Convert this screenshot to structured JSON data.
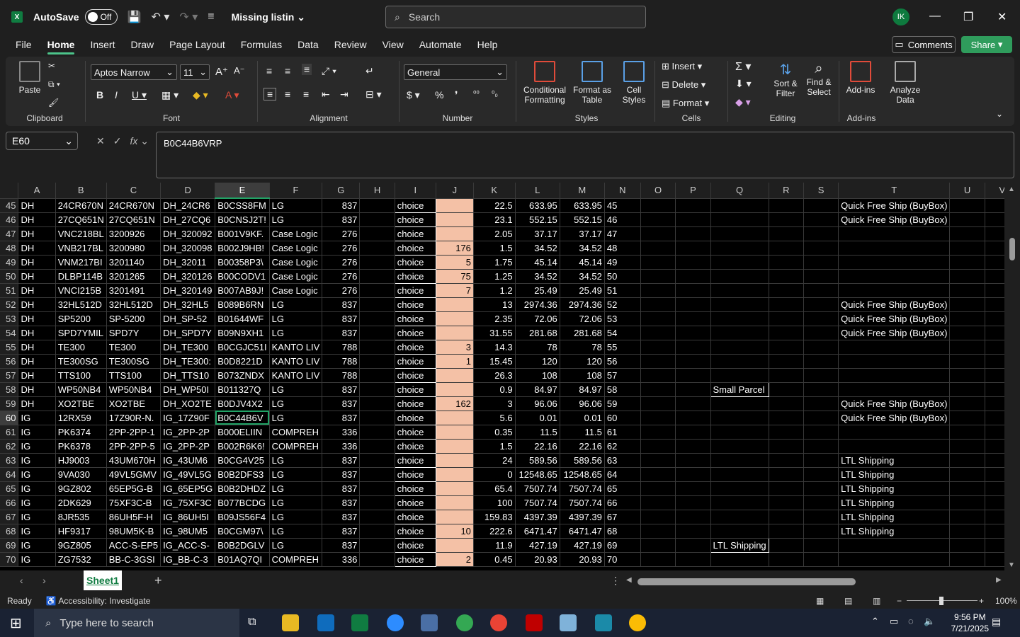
{
  "title": {
    "autosave": "AutoSave",
    "toggle": "Off",
    "doc_name": "Missing listin",
    "search_placeholder": "Search",
    "avatar": "IK"
  },
  "menu": [
    "File",
    "Home",
    "Insert",
    "Draw",
    "Page Layout",
    "Formulas",
    "Data",
    "Review",
    "View",
    "Automate",
    "Help"
  ],
  "comments": "Comments",
  "share": "Share",
  "ribbon": {
    "clipboard": {
      "paste": "Paste",
      "label": "Clipboard"
    },
    "font": {
      "family": "Aptos Narrow",
      "size": "11",
      "label": "Font"
    },
    "alignment": {
      "label": "Alignment"
    },
    "number": {
      "format": "General",
      "label": "Number"
    },
    "styles": {
      "cond": "Conditional Formatting",
      "fmt_table": "Format as Table",
      "cell_styles": "Cell Styles",
      "label": "Styles"
    },
    "cells": {
      "insert": "Insert",
      "delete": "Delete",
      "format": "Format",
      "label": "Cells"
    },
    "editing": {
      "sort": "Sort & Filter",
      "find": "Find & Select",
      "label": "Editing"
    },
    "addins": {
      "addins": "Add-ins",
      "analyze": "Analyze Data",
      "label": "Add-ins"
    }
  },
  "formula_bar": {
    "name_box": "E60",
    "value": "B0C44B6VRP"
  },
  "columns": [
    "A",
    "B",
    "C",
    "D",
    "E",
    "F",
    "G",
    "H",
    "I",
    "J",
    "K",
    "L",
    "M",
    "N",
    "O",
    "P",
    "Q",
    "R",
    "S",
    "T",
    "U",
    "V"
  ],
  "rows": [
    {
      "n": "45",
      "a": "DH",
      "b": "24CR670N",
      "c": "24CR670N",
      "d": "DH_24CR6",
      "e": "B0CSS8FM",
      "f": "LG",
      "g": "837",
      "i": "choice",
      "j": "",
      "k": "22.5",
      "l": "633.95",
      "m": "633.95",
      "q": "",
      "t": "Quick Free Ship (BuyBox)"
    },
    {
      "n": "46",
      "a": "DH",
      "b": "27CQ651N",
      "c": "27CQ651N",
      "d": "DH_27CQ6",
      "e": "B0CNSJ2T!",
      "f": "LG",
      "g": "837",
      "i": "choice",
      "j": "",
      "k": "23.1",
      "l": "552.15",
      "m": "552.15",
      "q": "",
      "t": "Quick Free Ship (BuyBox)"
    },
    {
      "n": "47",
      "a": "DH",
      "b": "VNC218BL",
      "c": "3200926",
      "d": "DH_320092",
      "e": "B001V9KF.",
      "f": "Case Logic",
      "g": "276",
      "i": "choice",
      "j": "",
      "k": "2.05",
      "l": "37.17",
      "m": "37.17",
      "q": "",
      "t": ""
    },
    {
      "n": "48",
      "a": "DH",
      "b": "VNB217BL",
      "c": "3200980",
      "d": "DH_320098",
      "e": "B002J9HB!",
      "f": "Case Logic",
      "g": "276",
      "i": "choice",
      "j": "176",
      "k": "1.5",
      "l": "34.52",
      "m": "34.52",
      "q": "",
      "t": ""
    },
    {
      "n": "49",
      "a": "DH",
      "b": "VNM217BI",
      "c": "3201140",
      "d": "DH_32011",
      "e": "B00358P3\\",
      "f": "Case Logic",
      "g": "276",
      "i": "choice",
      "j": "5",
      "k": "1.75",
      "l": "45.14",
      "m": "45.14",
      "q": "",
      "t": ""
    },
    {
      "n": "50",
      "a": "DH",
      "b": "DLBP114B",
      "c": "3201265",
      "d": "DH_320126",
      "e": "B00CODV1",
      "f": "Case Logic",
      "g": "276",
      "i": "choice",
      "j": "75",
      "k": "1.25",
      "l": "34.52",
      "m": "34.52",
      "q": "",
      "t": ""
    },
    {
      "n": "51",
      "a": "DH",
      "b": "VNCI215B",
      "c": "3201491",
      "d": "DH_320149",
      "e": "B007AB9J!",
      "f": "Case Logic",
      "g": "276",
      "i": "choice",
      "j": "7",
      "k": "1.2",
      "l": "25.49",
      "m": "25.49",
      "q": "",
      "t": ""
    },
    {
      "n": "52",
      "a": "DH",
      "b": "32HL512D",
      "c": "32HL512D",
      "d": "DH_32HL5",
      "e": "B089B6RN",
      "f": "LG",
      "g": "837",
      "i": "choice",
      "j": "",
      "k": "13",
      "l": "2974.36",
      "m": "2974.36",
      "q": "",
      "t": "Quick Free Ship (BuyBox)"
    },
    {
      "n": "53",
      "a": "DH",
      "b": "SP5200",
      "c": "SP-5200",
      "d": "DH_SP-52",
      "e": "B01644WF",
      "f": "LG",
      "g": "837",
      "i": "choice",
      "j": "",
      "k": "2.35",
      "l": "72.06",
      "m": "72.06",
      "q": "",
      "t": "Quick Free Ship (BuyBox)"
    },
    {
      "n": "54",
      "a": "DH",
      "b": "SPD7YMIL",
      "c": "SPD7Y",
      "d": "DH_SPD7Y",
      "e": "B09N9XH1",
      "f": "LG",
      "g": "837",
      "i": "choice",
      "j": "",
      "k": "31.55",
      "l": "281.68",
      "m": "281.68",
      "q": "",
      "t": "Quick Free Ship (BuyBox)"
    },
    {
      "n": "55",
      "a": "DH",
      "b": "TE300",
      "c": "TE300",
      "d": "DH_TE300",
      "e": "B0CGJC51I",
      "f": "KANTO LIV",
      "g": "788",
      "i": "choice",
      "j": "3",
      "k": "14.3",
      "l": "78",
      "m": "78",
      "q": "",
      "t": ""
    },
    {
      "n": "56",
      "a": "DH",
      "b": "TE300SG",
      "c": "TE300SG",
      "d": "DH_TE300:",
      "e": "B0D8221D",
      "f": "KANTO LIV",
      "g": "788",
      "i": "choice",
      "j": "1",
      "k": "15.45",
      "l": "120",
      "m": "120",
      "q": "",
      "t": ""
    },
    {
      "n": "57",
      "a": "DH",
      "b": "TTS100",
      "c": "TTS100",
      "d": "DH_TTS10",
      "e": "B073ZNDX",
      "f": "KANTO LIV",
      "g": "788",
      "i": "choice",
      "j": "",
      "k": "26.3",
      "l": "108",
      "m": "108",
      "q": "",
      "t": ""
    },
    {
      "n": "58",
      "a": "DH",
      "b": "WP50NB4",
      "c": "WP50NB4",
      "d": "DH_WP50I",
      "e": "B011327Q",
      "f": "LG",
      "g": "837",
      "i": "choice",
      "j": "",
      "k": "0.9",
      "l": "84.97",
      "m": "84.97",
      "q": "Small Parcel",
      "t": ""
    },
    {
      "n": "59",
      "a": "DH",
      "b": "XO2TBE",
      "c": "XO2TBE",
      "d": "DH_XO2TE",
      "e": "B0DJV4X2",
      "f": "LG",
      "g": "837",
      "i": "choice",
      "j": "162",
      "k": "3",
      "l": "96.06",
      "m": "96.06",
      "q": "",
      "t": "Quick Free Ship (BuyBox)"
    },
    {
      "n": "60",
      "a": "IG",
      "b": "12RX59",
      "c": "17Z90R-N.",
      "d": "IG_17Z90F",
      "e": "B0C44B6V",
      "f": "LG",
      "g": "837",
      "i": "choice",
      "j": "",
      "k": "5.6",
      "l": "0.01",
      "m": "0.01",
      "q": "",
      "t": "Quick Free Ship (BuyBox)"
    },
    {
      "n": "61",
      "a": "IG",
      "b": "PK6374",
      "c": "2PP-2PP-1",
      "d": "IG_2PP-2P",
      "e": "B000ELIIN",
      "f": "COMPREH",
      "g": "336",
      "i": "choice",
      "j": "",
      "k": "0.35",
      "l": "11.5",
      "m": "11.5",
      "q": "",
      "t": ""
    },
    {
      "n": "62",
      "a": "IG",
      "b": "PK6378",
      "c": "2PP-2PP-5",
      "d": "IG_2PP-2P",
      "e": "B002R6K6!",
      "f": "COMPREH",
      "g": "336",
      "i": "choice",
      "j": "",
      "k": "1.5",
      "l": "22.16",
      "m": "22.16",
      "q": "",
      "t": ""
    },
    {
      "n": "63",
      "a": "IG",
      "b": "HJ9003",
      "c": "43UM670H",
      "d": "IG_43UM6",
      "e": "B0CG4V25",
      "f": "LG",
      "g": "837",
      "i": "choice",
      "j": "",
      "k": "24",
      "l": "589.56",
      "m": "589.56",
      "q": "",
      "t": "LTL Shipping"
    },
    {
      "n": "64",
      "a": "IG",
      "b": "9VA030",
      "c": "49VL5GMV",
      "d": "IG_49VL5G",
      "e": "B0B2DFS3",
      "f": "LG",
      "g": "837",
      "i": "choice",
      "j": "",
      "k": "0",
      "l": "12548.65",
      "m": "12548.65",
      "q": "",
      "t": "LTL Shipping"
    },
    {
      "n": "65",
      "a": "IG",
      "b": "9GZ802",
      "c": "65EP5G-B",
      "d": "IG_65EP5G",
      "e": "B0B2DHDZ",
      "f": "LG",
      "g": "837",
      "i": "choice",
      "j": "",
      "k": "65.4",
      "l": "7507.74",
      "m": "7507.74",
      "q": "",
      "t": "LTL Shipping"
    },
    {
      "n": "66",
      "a": "IG",
      "b": "2DK629",
      "c": "75XF3C-B",
      "d": "IG_75XF3C",
      "e": "B077BCDG",
      "f": "LG",
      "g": "837",
      "i": "choice",
      "j": "",
      "k": "100",
      "l": "7507.74",
      "m": "7507.74",
      "q": "",
      "t": "LTL Shipping"
    },
    {
      "n": "67",
      "a": "IG",
      "b": "8JR535",
      "c": "86UH5F-H",
      "d": "IG_86UH5I",
      "e": "B09JS56F4",
      "f": "LG",
      "g": "837",
      "i": "choice",
      "j": "",
      "k": "159.83",
      "l": "4397.39",
      "m": "4397.39",
      "q": "",
      "t": "LTL Shipping"
    },
    {
      "n": "68",
      "a": "IG",
      "b": "HF9317",
      "c": "98UM5K-B",
      "d": "IG_98UM5",
      "e": "B0CGM97\\",
      "f": "LG",
      "g": "837",
      "i": "choice",
      "j": "10",
      "k": "222.6",
      "l": "6471.47",
      "m": "6471.47",
      "q": "",
      "t": "LTL Shipping"
    },
    {
      "n": "69",
      "a": "IG",
      "b": "9GZ805",
      "c": "ACC-S-EP5",
      "d": "IG_ACC-S-",
      "e": "B0B2DGLV",
      "f": "LG",
      "g": "837",
      "i": "choice",
      "j": "",
      "k": "11.9",
      "l": "427.19",
      "m": "427.19",
      "q": "LTL Shipping",
      "t": ""
    },
    {
      "n": "70",
      "a": "IG",
      "b": "ZG7532",
      "c": "BB-C-3GSI",
      "d": "IG_BB-C-3",
      "e": "B01AQ7QI",
      "f": "COMPREH",
      "g": "336",
      "i": "choice",
      "j": "2",
      "k": "0.45",
      "l": "20.93",
      "m": "20.93",
      "q": "",
      "t": ""
    }
  ],
  "sheet_tab": "Sheet1",
  "status": {
    "ready": "Ready",
    "accessibility": "Accessibility: Investigate",
    "zoom": "100%"
  },
  "taskbar": {
    "search": "Type here to search",
    "time": "9:56 PM",
    "date": "7/21/2025"
  }
}
